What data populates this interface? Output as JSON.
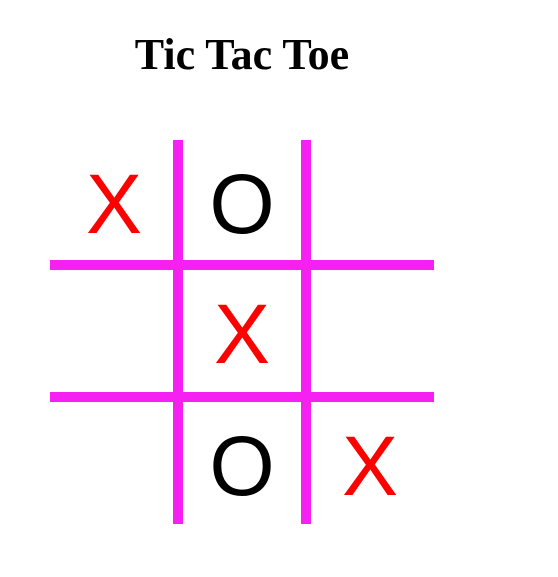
{
  "title": "Tic Tac Toe",
  "colors": {
    "grid": "#f521f2",
    "x_mark": "#fd0000",
    "o_mark": "#000000"
  },
  "board": {
    "cells": [
      {
        "mark": "X"
      },
      {
        "mark": "O"
      },
      {
        "mark": ""
      },
      {
        "mark": ""
      },
      {
        "mark": "X"
      },
      {
        "mark": ""
      },
      {
        "mark": ""
      },
      {
        "mark": "O"
      },
      {
        "mark": "X"
      }
    ]
  }
}
